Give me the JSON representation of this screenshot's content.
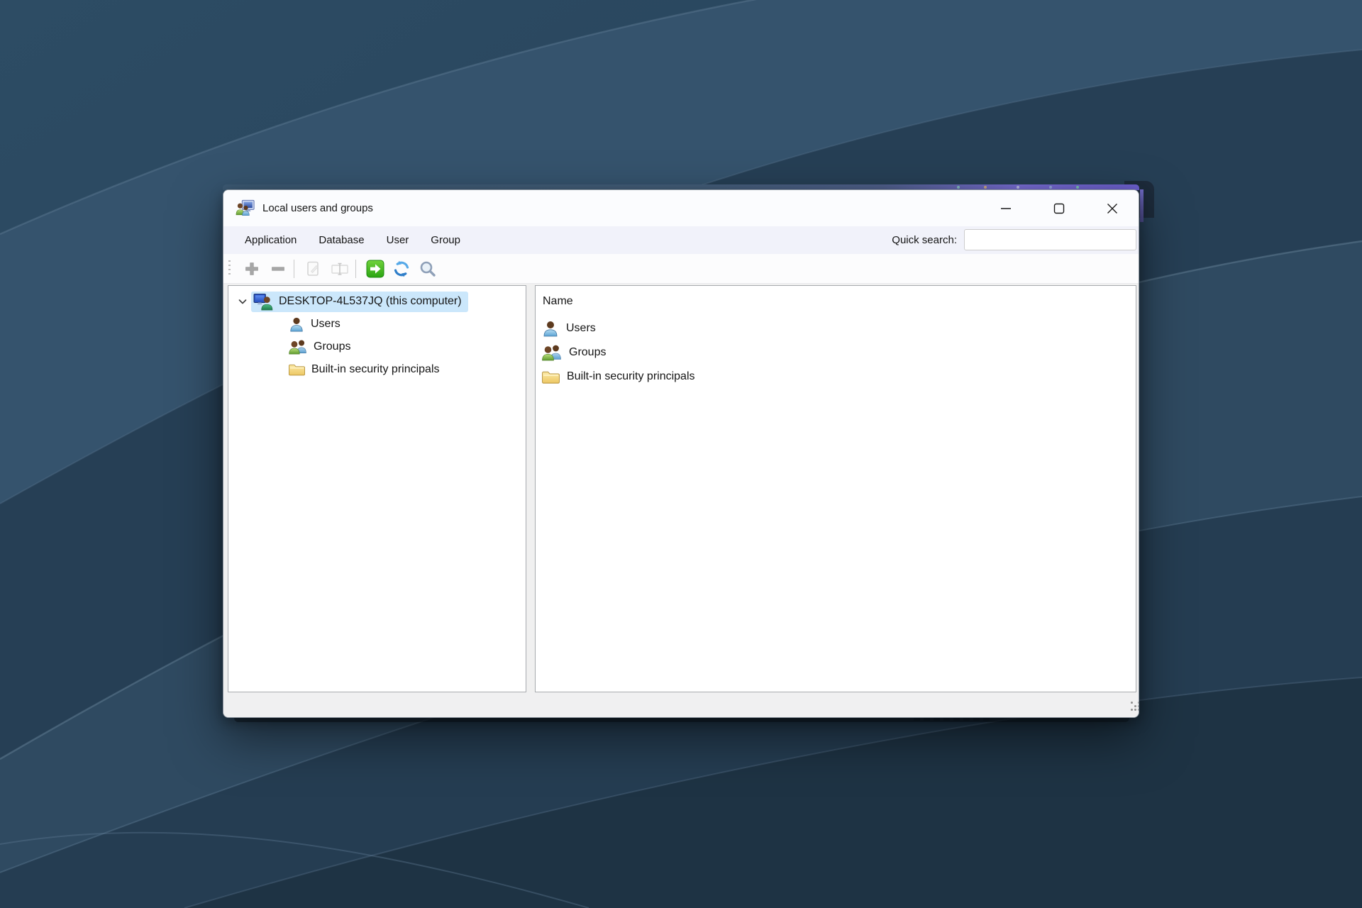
{
  "window": {
    "title": "Local users and groups",
    "menu": {
      "items": [
        {
          "label": "Application"
        },
        {
          "label": "Database"
        },
        {
          "label": "User"
        },
        {
          "label": "Group"
        }
      ],
      "quick_search": {
        "label": "Quick search:",
        "value": ""
      }
    },
    "toolbar": {
      "buttons": [
        {
          "name": "add",
          "enabled": true
        },
        {
          "name": "remove",
          "enabled": true
        },
        {
          "name": "edit",
          "enabled": false
        },
        {
          "name": "rename",
          "enabled": false
        },
        {
          "name": "go",
          "enabled": true
        },
        {
          "name": "refresh",
          "enabled": true
        },
        {
          "name": "search",
          "enabled": true
        }
      ]
    },
    "tree": {
      "root": {
        "label": "DESKTOP-4L537JQ (this computer)",
        "selected": true,
        "expanded": true,
        "children": [
          {
            "label": "Users",
            "icon": "user-icon"
          },
          {
            "label": "Groups",
            "icon": "group-icon"
          },
          {
            "label": "Built-in security principals",
            "icon": "folder-icon"
          }
        ]
      }
    },
    "list": {
      "columns": [
        {
          "label": "Name"
        }
      ],
      "rows": [
        {
          "label": "Users",
          "icon": "user-icon"
        },
        {
          "label": "Groups",
          "icon": "group-icon"
        },
        {
          "label": "Built-in security principals",
          "icon": "folder-icon"
        }
      ]
    }
  },
  "icons": {
    "app": "two-users-with-computer",
    "tree_root": "user-with-computer",
    "toolbar": [
      "plus",
      "minus",
      "edit-document",
      "rename-box",
      "green-arrow-right",
      "refresh-arrows",
      "magnifier"
    ],
    "window_controls": [
      "minimize",
      "maximize",
      "close"
    ]
  },
  "colors": {
    "selection": "#cbe7fb",
    "titlebar": "#fbfcfe",
    "menubar": "#f1f2fa",
    "toolbar": "#fcfcfd",
    "content_bg": "#f0f0f0",
    "pane_border": "#a7aaae",
    "desktop_base": "#27425a",
    "accent_green": "#2aa412",
    "accent_blue": "#3a8fd8"
  }
}
